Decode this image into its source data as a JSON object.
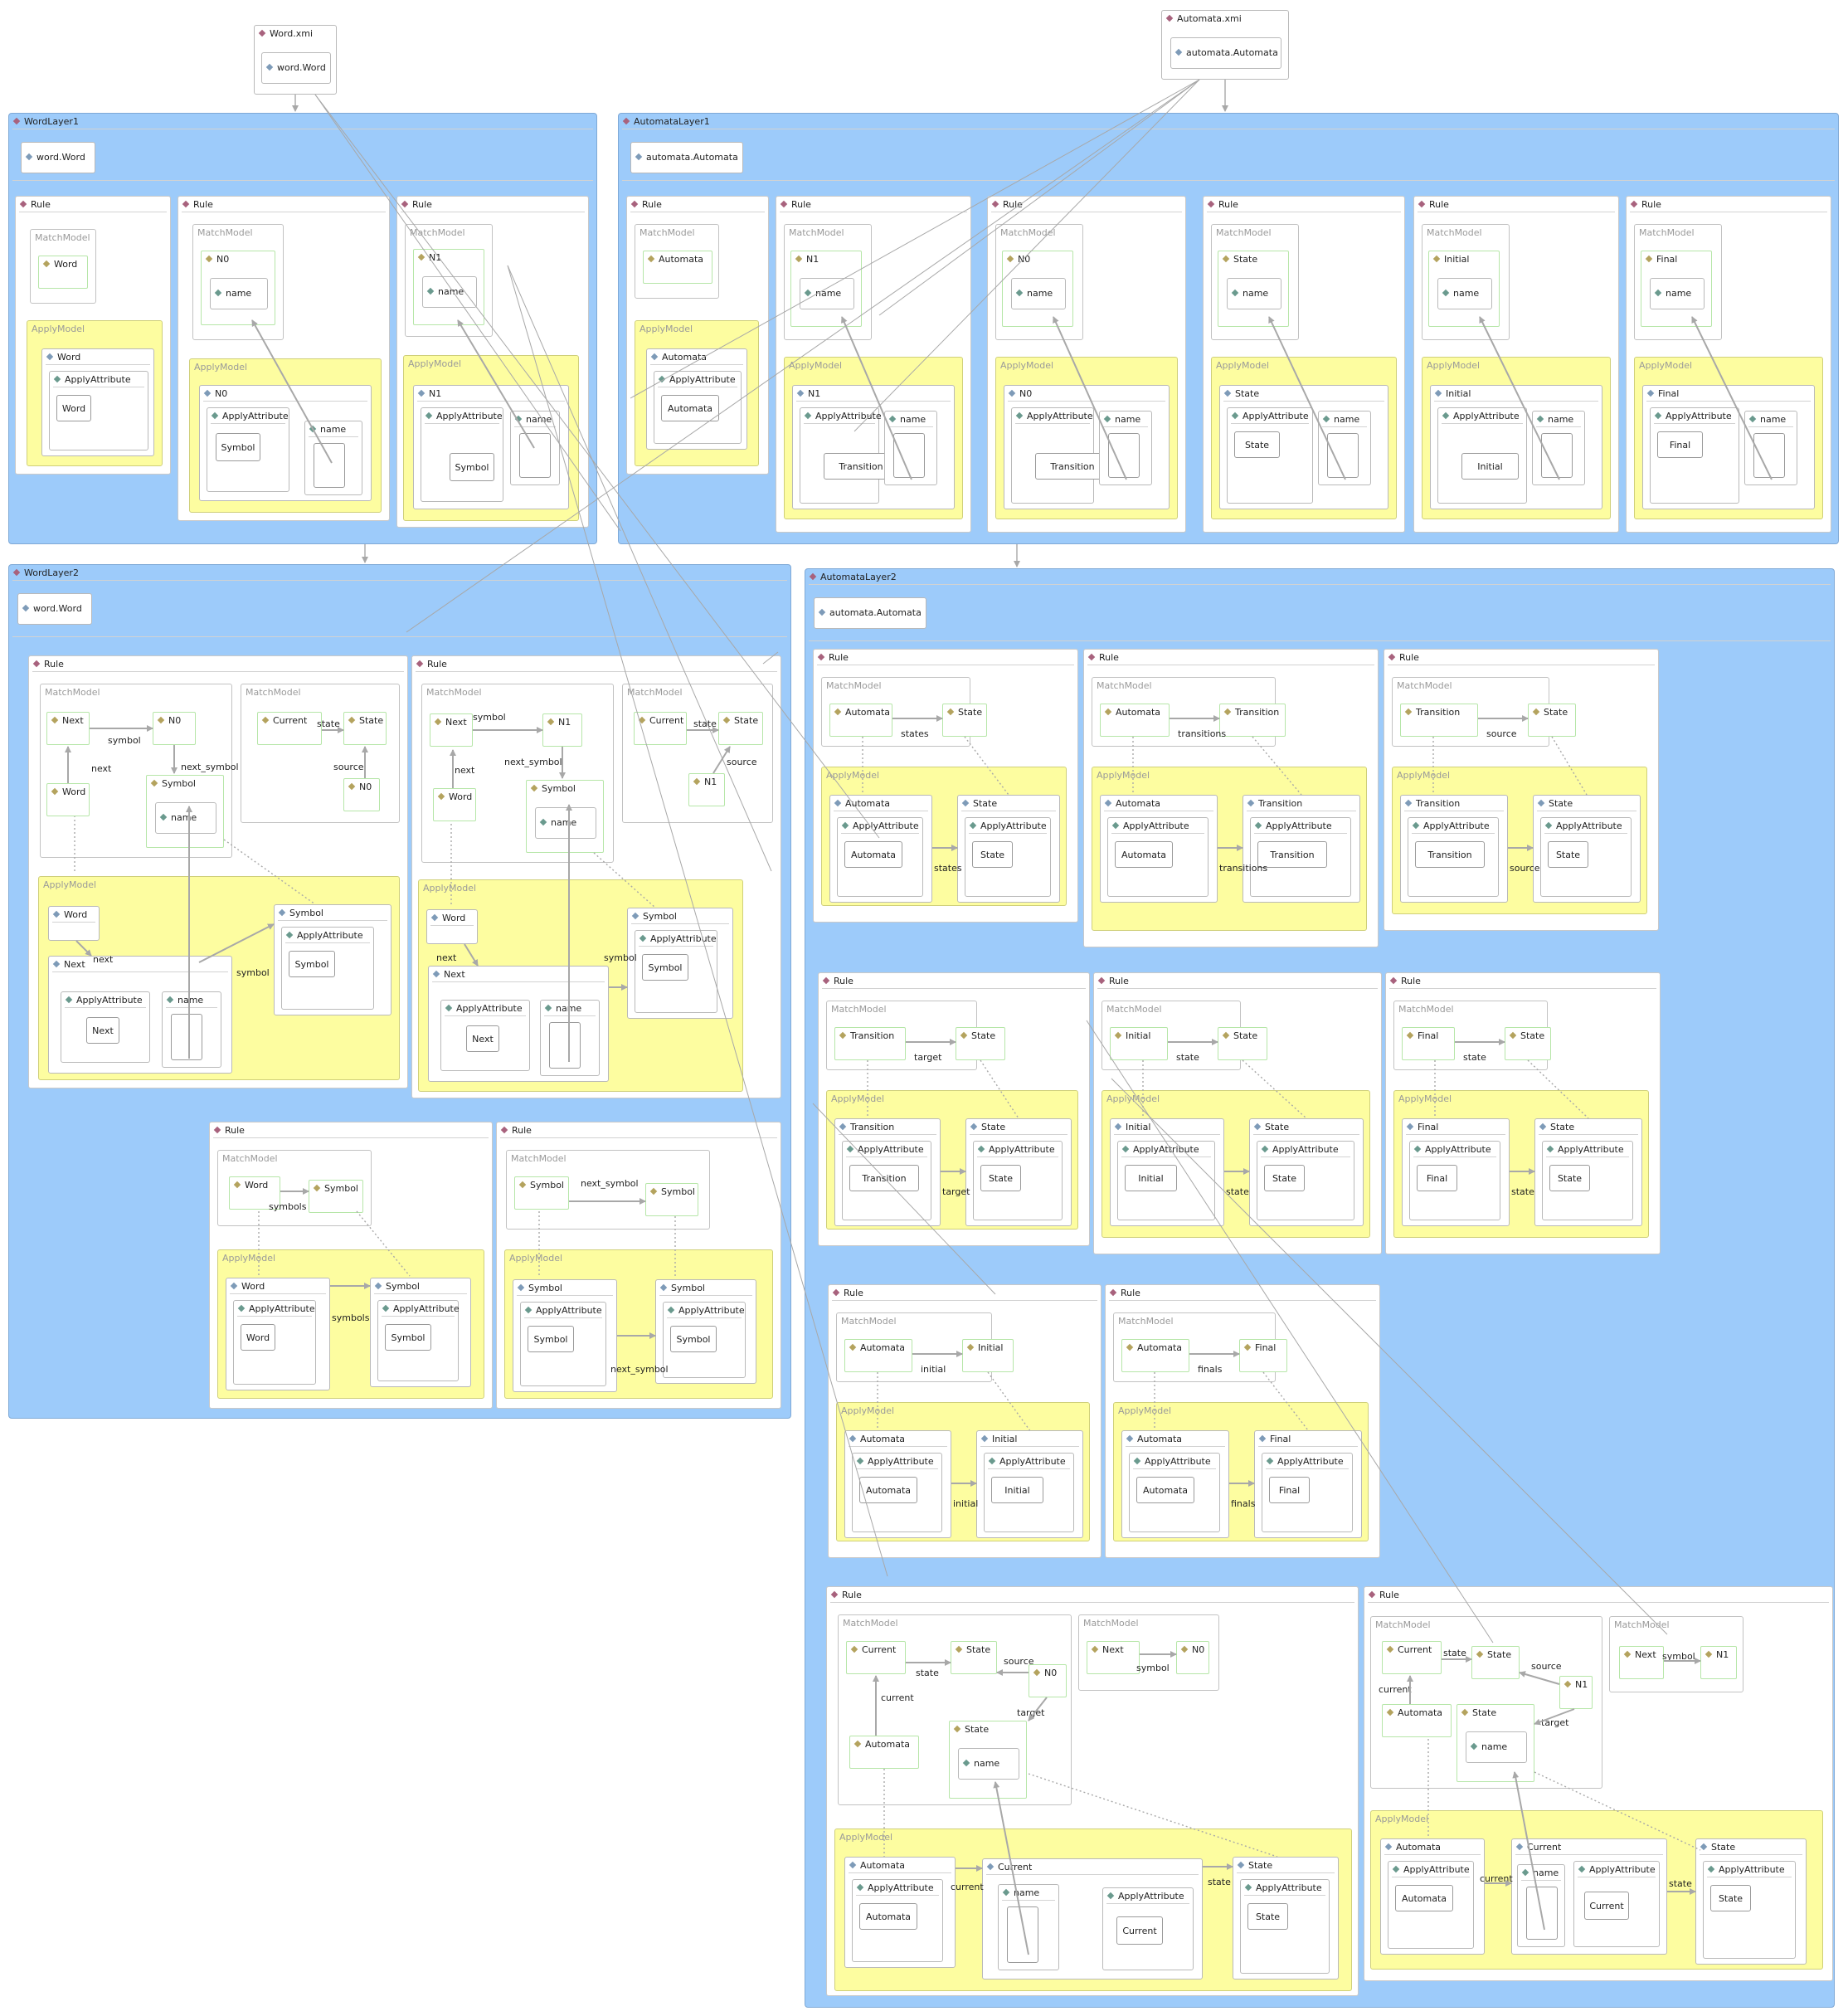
{
  "models": {
    "word": {
      "file": "Word.xmi",
      "root": "word.Word"
    },
    "automata": {
      "file": "Automata.xmi",
      "root": "automata.Automata"
    }
  },
  "layers": {
    "word1": {
      "title": "WordLayer1",
      "model": "word.Word"
    },
    "automata1": {
      "title": "AutomataLayer1",
      "model": "automata.Automata"
    },
    "word2": {
      "title": "WordLayer2",
      "model": "word.Word"
    },
    "automata2": {
      "title": "AutomataLayer2",
      "model": "automata.Automata"
    }
  },
  "labels": {
    "rule": "Rule",
    "match": "MatchModel",
    "apply": "ApplyModel",
    "apply_attr": "ApplyAttribute",
    "name": "name"
  },
  "types": {
    "word": "Word",
    "n0": "N0",
    "n1": "N1",
    "next": "Next",
    "symbol": "Symbol",
    "current": "Current",
    "state": "State",
    "automata": "Automata",
    "transition": "Transition",
    "initial": "Initial",
    "final": "Final"
  },
  "refs": {
    "symbol": "symbol",
    "next_symbol": "next_symbol",
    "next": "next",
    "state": "state",
    "source": "source",
    "target": "target",
    "states": "states",
    "transitions": "transitions",
    "symbols": "symbols",
    "initial": "initial",
    "finals": "finals",
    "current": "current"
  }
}
